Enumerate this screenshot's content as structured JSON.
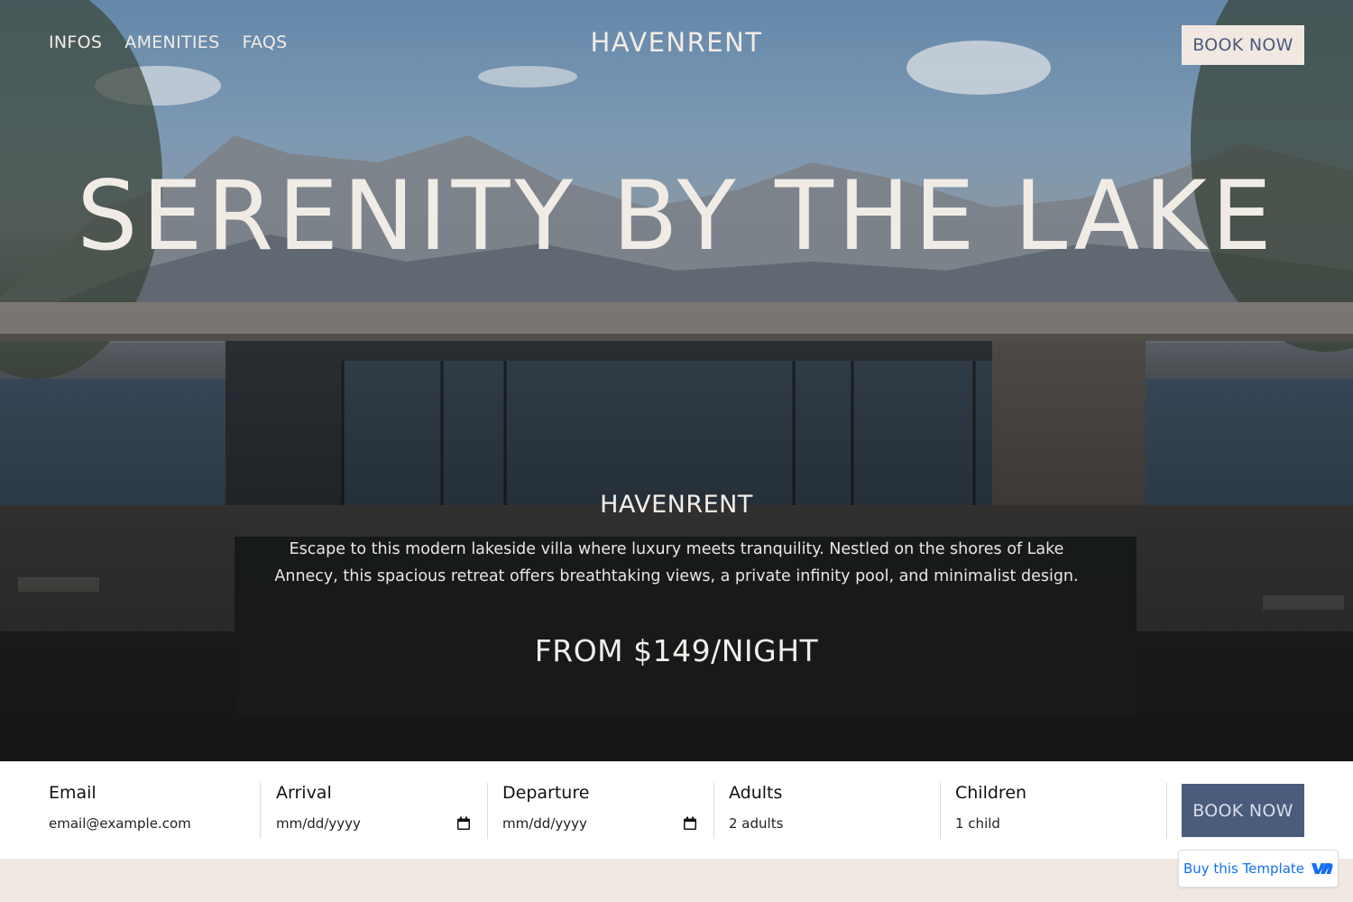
{
  "nav": {
    "links": [
      "INFOS",
      "AMENITIES",
      "FAQS"
    ],
    "logo": "HAVENRENT",
    "book_label": "BOOK NOW"
  },
  "hero": {
    "headline": "SERENITY BY THE LAKE",
    "brand": "HAVENRENT",
    "description": "Escape to this modern lakeside villa where luxury meets tranquility. Nestled on the shores of Lake Annecy, this spacious retreat offers breathtaking views, a private infinity pool, and minimalist design.",
    "price": "FROM $149/NIGHT"
  },
  "booking": {
    "email": {
      "label": "Email",
      "placeholder": "email@example.com"
    },
    "arrival": {
      "label": "Arrival",
      "placeholder": "mm/dd/yyyy"
    },
    "departure": {
      "label": "Departure",
      "placeholder": "mm/dd/yyyy"
    },
    "adults": {
      "label": "Adults",
      "value": "2 adults"
    },
    "children": {
      "label": "Children",
      "value": "1 child"
    },
    "submit_label": "BOOK NOW"
  },
  "badge": {
    "label": "Buy this Template",
    "icon": "webflow-icon"
  },
  "colors": {
    "accent": "#4b5b7b",
    "cream": "#f1e8e2",
    "badge_blue": "#146ef5"
  }
}
